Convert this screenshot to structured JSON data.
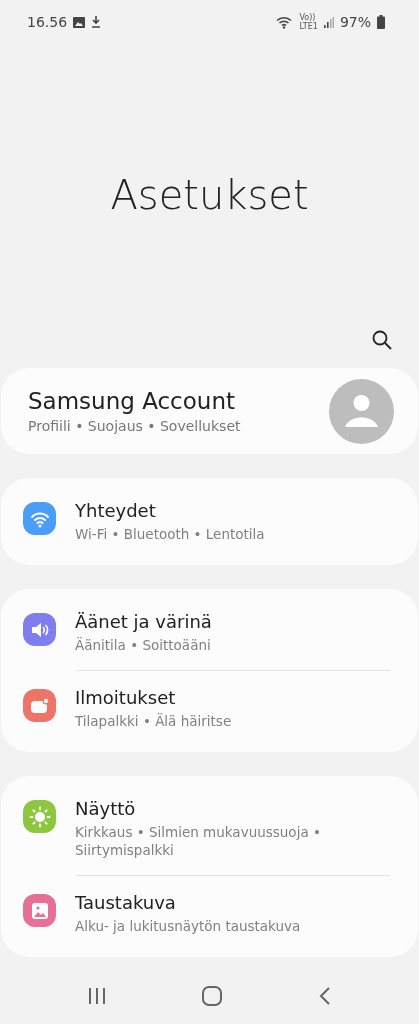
{
  "status_bar": {
    "time": "16.56",
    "volte": "Vo))",
    "network": "LTE1",
    "battery": "97%"
  },
  "title": "Asetukset",
  "account": {
    "title": "Samsung Account",
    "subtitle": "Profiili  •  Suojaus  •  Sovellukset"
  },
  "groups": [
    {
      "items": [
        {
          "kind": "wifi",
          "color": "#4a9df8",
          "title": "Yhteydet",
          "subtitle": "Wi-Fi  •  Bluetooth  •  Lentotila"
        }
      ]
    },
    {
      "items": [
        {
          "kind": "sound",
          "color": "#7f7ef0",
          "title": "Äänet ja värinä",
          "subtitle": "Äänitila  •  Soittoääni"
        },
        {
          "kind": "notification",
          "color": "#ef7468",
          "title": "Ilmoitukset",
          "subtitle": "Tilapalkki  •  Älä häiritse"
        }
      ]
    },
    {
      "items": [
        {
          "kind": "display",
          "color": "#8dc63f",
          "title": "Näyttö",
          "subtitle": "Kirkkaus  •  Silmien mukavuussuoja  •  Siirtymispalkki"
        },
        {
          "kind": "wallpaper",
          "color": "#e86f96",
          "title": "Taustakuva",
          "subtitle": "Alku- ja lukitusnäytön taustakuva"
        }
      ]
    }
  ]
}
